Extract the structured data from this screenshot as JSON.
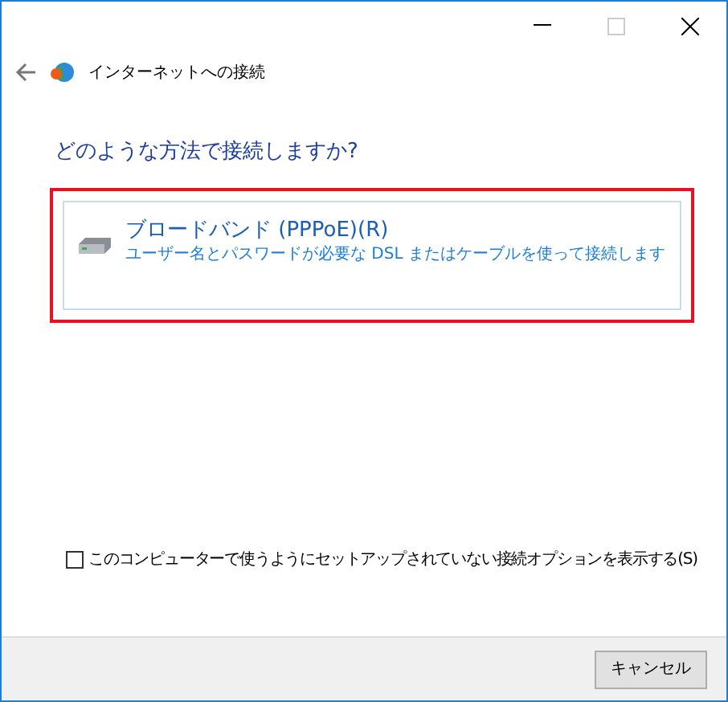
{
  "window": {
    "title": "インターネットへの接続"
  },
  "heading": "どのような方法で接続しますか?",
  "options": [
    {
      "title": "ブロードバンド (PPPoE)(R)",
      "description": "ユーザー名とパスワードが必要な DSL またはケーブルを使って接続します",
      "highlighted": true
    }
  ],
  "checkbox": {
    "label": "このコンピューターで使うようにセットアップされていない接続オプションを表示する(S)",
    "checked": false
  },
  "buttons": [
    "キャンセル"
  ]
}
